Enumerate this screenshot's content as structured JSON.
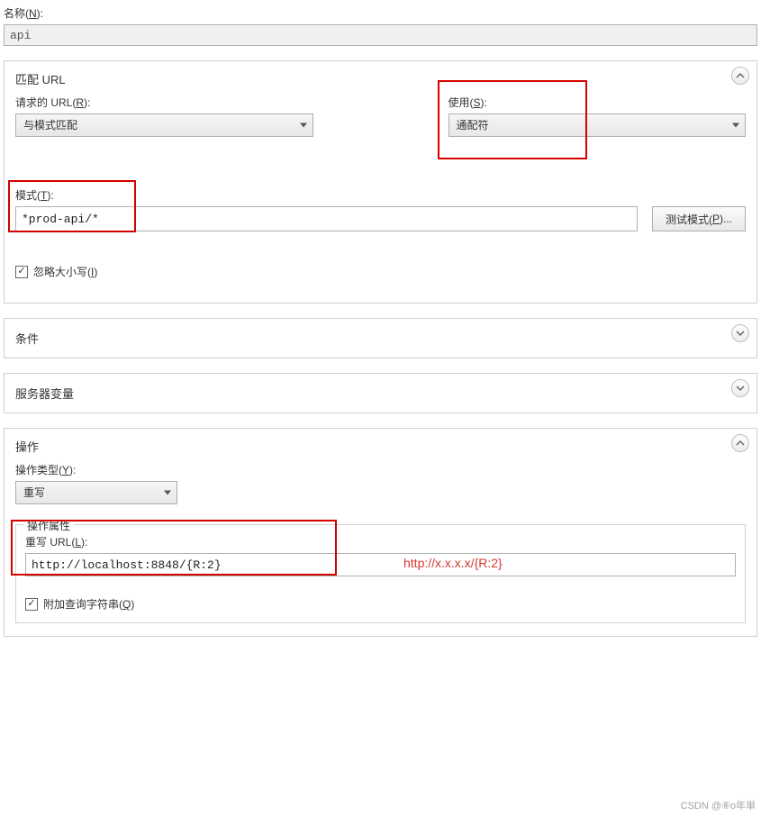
{
  "name_section": {
    "label_prefix": "名称(",
    "label_key": "N",
    "label_suffix": "):",
    "value": "api"
  },
  "match_url": {
    "title": "匹配 URL",
    "request_url": {
      "label_prefix": "请求的 URL(",
      "label_key": "R",
      "label_suffix": "):",
      "selected": "与模式匹配"
    },
    "using": {
      "label_prefix": "使用(",
      "label_key": "S",
      "label_suffix": "):",
      "selected": "通配符"
    },
    "pattern": {
      "label_prefix": "模式(",
      "label_key": "T",
      "label_suffix": "):",
      "value": "*prod-api/*"
    },
    "test_button": {
      "label_prefix": "测试模式(",
      "label_key": "P",
      "label_suffix": ")..."
    },
    "ignore_case": {
      "checked": true,
      "label_prefix": "忽略大小写(",
      "label_key": "I",
      "label_suffix": ")"
    }
  },
  "conditions": {
    "title": "条件"
  },
  "server_vars": {
    "title": "服务器变量"
  },
  "action": {
    "title": "操作",
    "type_label_prefix": "操作类型(",
    "type_label_key": "Y",
    "type_label_suffix": "):",
    "type_selected": "重写",
    "props_legend": "操作属性",
    "rewrite_url": {
      "label_prefix": "重写 URL(",
      "label_key": "L",
      "label_suffix": "):",
      "value": "http://localhost:8848/{R:2}",
      "annotation": "http://x.x.x.x/{R:2}"
    },
    "append_qs": {
      "checked": true,
      "label_prefix": "附加查询字符串(",
      "label_key": "Q",
      "label_suffix": ")"
    }
  },
  "watermark": "CSDN @⑧o年単"
}
